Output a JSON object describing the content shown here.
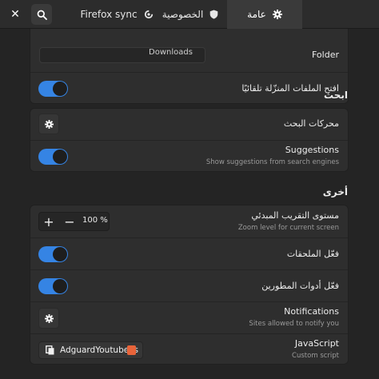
{
  "header": {
    "tabs": [
      {
        "label": "Firefox sync",
        "icon": "sync-icon"
      },
      {
        "label": "الخصوصية",
        "icon": "shield-icon"
      },
      {
        "label": "عامة",
        "icon": "gear-icon",
        "active": true
      }
    ]
  },
  "downloads": {
    "folder_row_title": "Folder",
    "folder_value": "Downloads",
    "open_auto_label": "افتح الملفات المنزّلة تلقائيًا",
    "open_auto_on": true
  },
  "search_section": {
    "title": "ابحث",
    "engines_label": "محركات البحث",
    "suggestions_title": "Suggestions",
    "suggestions_sub": "Show suggestions from search engines",
    "suggestions_on": true
  },
  "other_section": {
    "title": "أخرى",
    "zoom_title": "مستوى التقريب المبدئي",
    "zoom_sub": "Zoom level for current screen",
    "zoom_value": "100 %",
    "addons_label": "فعّل الملحقات",
    "addons_on": true,
    "devtools_label": "فعّل أدوات المطورين",
    "devtools_on": true,
    "notifications_title": "Notifications",
    "notifications_sub": "Sites allowed to notify you",
    "javascript_title": "JavaScript",
    "javascript_sub": "Custom script",
    "javascript_file": "AdguardYoutube.js"
  },
  "colors": {
    "accent": "#3584e4",
    "background": "#242424",
    "card": "#2e2e2e"
  }
}
